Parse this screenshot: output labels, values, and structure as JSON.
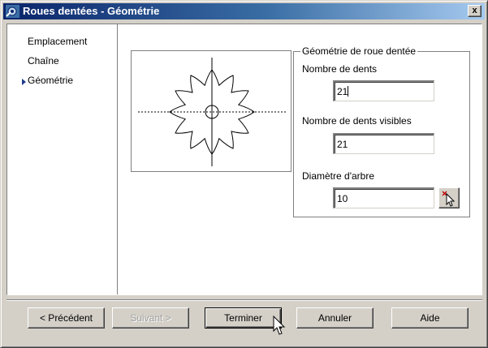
{
  "window": {
    "title": "Roues dentées - Géométrie",
    "close_glyph": "x"
  },
  "nav": {
    "items": [
      {
        "label": "Emplacement",
        "active": false
      },
      {
        "label": "Chaîne",
        "active": false
      },
      {
        "label": "Géométrie",
        "active": true
      }
    ]
  },
  "group": {
    "title": "Géométrie de roue dentée",
    "teeth_label": "Nombre de dents",
    "teeth_value": "21",
    "visible_teeth_label": "Nombre de dents visibles",
    "visible_teeth_value": "21",
    "shaft_label": "Diamètre d'arbre",
    "shaft_value": "10"
  },
  "preview": {
    "tooth_count": 12
  },
  "buttons": {
    "previous": "< Précédent",
    "next": "Suivant >",
    "finish": "Terminer",
    "cancel": "Annuler",
    "help": "Aide"
  },
  "colors": {
    "dialog": "#d4d0c8",
    "title_start": "#0a246a",
    "title_end": "#a6caf0",
    "nav_arrow": "#1f3d8a"
  }
}
